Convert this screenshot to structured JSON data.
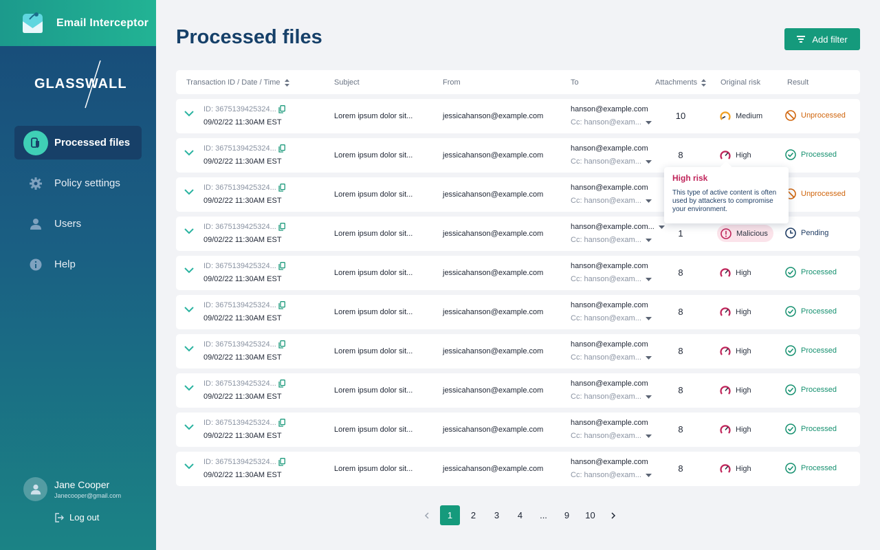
{
  "app": {
    "name": "Email Interceptor",
    "logo_text": "GLASSWALL"
  },
  "sidebar": {
    "items": [
      {
        "label": "Processed files",
        "icon": "file-shield-icon",
        "active": true
      },
      {
        "label": "Policy settings",
        "icon": "gear-icon",
        "active": false
      },
      {
        "label": "Users",
        "icon": "user-icon",
        "active": false
      },
      {
        "label": "Help",
        "icon": "info-icon",
        "active": false
      }
    ],
    "user": {
      "name": "Jane Cooper",
      "email": "Janecooper@gmail.com"
    },
    "logout_label": "Log out"
  },
  "page": {
    "title": "Processed files",
    "add_filter_label": "Add filter"
  },
  "table": {
    "headers": {
      "transaction": "Transaction ID / Date / Time",
      "subject": "Subject",
      "from": "From",
      "to": "To",
      "attachments": "Attachments",
      "risk": "Original risk",
      "result": "Result"
    },
    "rows": [
      {
        "id": "ID: 3675139425324...",
        "date": "09/02/22 11:30AM EST",
        "subject": "Lorem ipsum dolor sit...",
        "from": "jessicahanson@example.com",
        "to": "hanson@example.com",
        "cc": "Cc: hanson@exam...",
        "attachments": "10",
        "risk": "Medium",
        "result": "Unprocessed"
      },
      {
        "id": "ID: 3675139425324...",
        "date": "09/02/22 11:30AM EST",
        "subject": "Lorem ipsum dolor sit...",
        "from": "jessicahanson@example.com",
        "to": "hanson@example.com",
        "cc": "Cc: hanson@exam...",
        "attachments": "8",
        "risk": "High",
        "result": "Processed"
      },
      {
        "id": "ID: 3675139425324...",
        "date": "09/02/22 11:30AM EST",
        "subject": "Lorem ipsum dolor sit...",
        "from": "jessicahanson@example.com",
        "to": "hanson@example.com",
        "cc": "Cc: hanson@exam...",
        "attachments": "",
        "risk": "",
        "result": "Unprocessed"
      },
      {
        "id": "ID: 3675139425324...",
        "date": "09/02/22 11:30AM EST",
        "subject": "Lorem ipsum dolor sit...",
        "from": "jessicahanson@example.com",
        "to": "hanson@example.com...",
        "cc": "Cc: hanson@exam...",
        "attachments": "1",
        "risk": "Malicious",
        "result": "Pending"
      },
      {
        "id": "ID: 3675139425324...",
        "date": "09/02/22 11:30AM EST",
        "subject": "Lorem ipsum dolor sit...",
        "from": "jessicahanson@example.com",
        "to": "hanson@example.com",
        "cc": "Cc: hanson@exam...",
        "attachments": "8",
        "risk": "High",
        "result": "Processed"
      },
      {
        "id": "ID: 3675139425324...",
        "date": "09/02/22 11:30AM EST",
        "subject": "Lorem ipsum dolor sit...",
        "from": "jessicahanson@example.com",
        "to": "hanson@example.com",
        "cc": "Cc: hanson@exam...",
        "attachments": "8",
        "risk": "High",
        "result": "Processed"
      },
      {
        "id": "ID: 3675139425324...",
        "date": "09/02/22 11:30AM EST",
        "subject": "Lorem ipsum dolor sit...",
        "from": "jessicahanson@example.com",
        "to": "hanson@example.com",
        "cc": "Cc: hanson@exam...",
        "attachments": "8",
        "risk": "High",
        "result": "Processed"
      },
      {
        "id": "ID: 3675139425324...",
        "date": "09/02/22 11:30AM EST",
        "subject": "Lorem ipsum dolor sit...",
        "from": "jessicahanson@example.com",
        "to": "hanson@example.com",
        "cc": "Cc: hanson@exam...",
        "attachments": "8",
        "risk": "High",
        "result": "Processed"
      },
      {
        "id": "ID: 3675139425324...",
        "date": "09/02/22 11:30AM EST",
        "subject": "Lorem ipsum dolor sit...",
        "from": "jessicahanson@example.com",
        "to": "hanson@example.com",
        "cc": "Cc: hanson@exam...",
        "attachments": "8",
        "risk": "High",
        "result": "Processed"
      },
      {
        "id": "ID: 3675139425324...",
        "date": "09/02/22 11:30AM EST",
        "subject": "Lorem ipsum dolor sit...",
        "from": "jessicahanson@example.com",
        "to": "hanson@example.com",
        "cc": "Cc: hanson@exam...",
        "attachments": "8",
        "risk": "High",
        "result": "Processed"
      }
    ]
  },
  "tooltip": {
    "title": "High risk",
    "body": "This type of active content is often used by attackers to compromise your environment."
  },
  "pagination": {
    "pages": [
      "1",
      "2",
      "3",
      "4",
      "...",
      "9",
      "10"
    ],
    "current": "1"
  },
  "colors": {
    "accent": "#159a7c",
    "title": "#164069",
    "high": "#c0245a",
    "medium": "#f0a020",
    "processed": "#15906f",
    "unprocessed": "#d0650c"
  }
}
